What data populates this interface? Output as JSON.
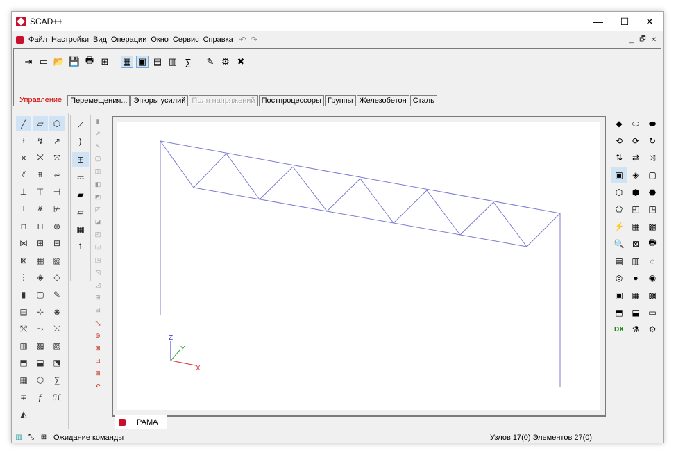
{
  "app": {
    "title": "SCAD++"
  },
  "window_controls": {
    "minimize": "—",
    "maximize": "☐",
    "close": "✕"
  },
  "menu": [
    "Файл",
    "Настройки",
    "Вид",
    "Операции",
    "Окно",
    "Сервис",
    "Справка"
  ],
  "mdi_controls": {
    "minimize": "_",
    "restore": "🗗",
    "close": "✕"
  },
  "toolbar": {
    "icons": [
      "import-icon",
      "new-icon",
      "open-icon",
      "save-icon",
      "print-icon",
      "tree-icon",
      "grid-icon",
      "calculator-icon",
      "monitor-icon",
      "html-report-icon",
      "formula-icon",
      "tools-icon",
      "settings-icon",
      "delete-icon"
    ],
    "glyphs": [
      "⇥",
      "▭",
      "📂",
      "💾",
      "🖶",
      "⊞",
      "▦",
      "▣",
      "▤",
      "▥",
      "∑",
      "✎",
      "⚙",
      "✖"
    ],
    "active_index": [
      6,
      7
    ]
  },
  "tabs": [
    {
      "label": "Управление",
      "state": "active"
    },
    {
      "label": "Перемещения...",
      "state": "normal"
    },
    {
      "label": "Эпюры усилий",
      "state": "normal"
    },
    {
      "label": "Поля напряжений",
      "state": "disabled"
    },
    {
      "label": "Постпроцессоры",
      "state": "normal"
    },
    {
      "label": "Группы",
      "state": "normal"
    },
    {
      "label": "Железобетон",
      "state": "normal"
    },
    {
      "label": "Сталь",
      "state": "normal"
    }
  ],
  "left_tools": {
    "glyphs": [
      "╱",
      "▱",
      "⬡",
      "⟊",
      "↯",
      "↗",
      "⨯",
      "⨉",
      "⤧",
      "⫽",
      "⩩",
      "⩫",
      "⊥",
      "⊤",
      "⊣",
      "⟂",
      "⨳",
      "⊬",
      "⊓",
      "⊔",
      "⊕",
      "⋈",
      "⊞",
      "⊟",
      "⊠",
      "▦",
      "▧",
      "⋮",
      "◈",
      "◇",
      "▮",
      "▢",
      "✎",
      "▤",
      "⊹",
      "⋇",
      "⤲",
      "⤳",
      "⤬",
      "▥",
      "▩",
      "▨",
      "⬒",
      "⬓",
      "⬔",
      "▦",
      "⬡",
      "∑",
      "∓",
      "ƒ",
      "ℋ",
      "◭"
    ],
    "selected": [
      0,
      1,
      2
    ]
  },
  "col2_tools": {
    "glyphs": [
      "⟋",
      "⟌",
      "⊞",
      "⎓",
      "▰",
      "▱",
      "▦"
    ],
    "selected": [
      2
    ],
    "counter": "1"
  },
  "col3_tools": {
    "glyphs": [
      "▮",
      "↗",
      "↖",
      "▢",
      "◫",
      "◧",
      "◩",
      "◸",
      "◪",
      "◰",
      "◲",
      "◳",
      "◹",
      "◿",
      "⊞",
      "⊟",
      "⤡",
      "⊕",
      "⊠",
      "⊡",
      "⊞",
      "↶"
    ]
  },
  "model": {
    "top_chord": [
      [
        230,
        202
      ],
      [
        421,
        239
      ],
      [
        614,
        273
      ],
      [
        806,
        306
      ]
    ],
    "bottom_chord": [
      [
        278,
        269
      ],
      [
        758,
        354
      ]
    ],
    "web_top": [
      [
        230,
        202
      ],
      [
        325,
        220
      ],
      [
        421,
        239
      ],
      [
        518,
        256
      ],
      [
        614,
        273
      ],
      [
        710,
        290
      ],
      [
        806,
        306
      ]
    ],
    "web_bottom": [
      [
        278,
        269
      ],
      [
        373,
        286
      ],
      [
        470,
        303
      ],
      [
        566,
        320
      ],
      [
        662,
        337
      ],
      [
        758,
        354
      ]
    ],
    "columns": [
      [
        [
          230,
          202
        ],
        [
          230,
          452
        ]
      ],
      [
        [
          806,
          306
        ],
        [
          806,
          556
        ]
      ]
    ],
    "color": "#7b7bd0"
  },
  "axes": {
    "x_label": "X",
    "y_label": "Y",
    "z_label": "Z",
    "x_color": "#e03030",
    "y_color": "#30a030",
    "z_color": "#3030e0"
  },
  "document_tab": {
    "label": "РАМА"
  },
  "right_tools": {
    "glyphs": [
      "◆",
      "⬭",
      "⬬",
      "⟲",
      "⟳",
      "↻",
      "⇅",
      "⇄",
      "⤨",
      "▣",
      "◈",
      "▢",
      "⬡",
      "⬢",
      "⬣",
      "⬠",
      "◰",
      "◳",
      "⚡",
      "▦",
      "▩",
      "🔍",
      "⊠",
      "🖶",
      "▤",
      "▥",
      "◌",
      "◎",
      "●",
      "◉",
      "▣",
      "▦",
      "▩",
      "⬒",
      "⬓",
      "▭",
      "DX",
      "⚗",
      "⚙"
    ],
    "selected": [
      9
    ]
  },
  "status": {
    "message": "Ожидание команды",
    "info": "Узлов 17(0) Элементов 27(0)"
  }
}
